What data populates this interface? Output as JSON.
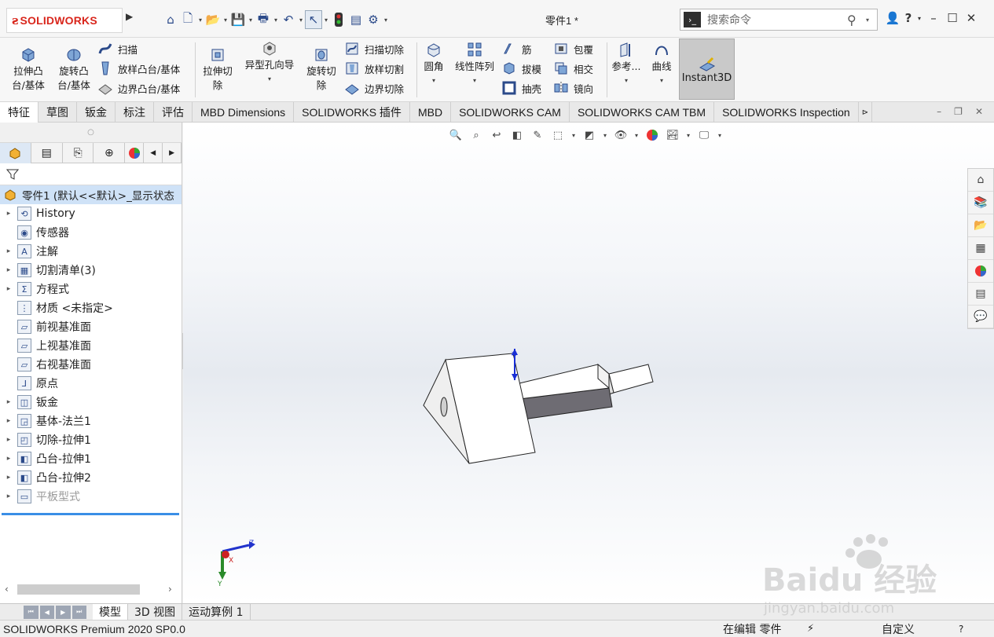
{
  "app": {
    "logo_text": "SOLIDWORKS",
    "document_title": "零件1 *",
    "search_placeholder": "搜索命令"
  },
  "ribbon": {
    "extrude_boss": "拉伸凸\n台/基体",
    "revolve_boss": "旋转凸\n台/基体",
    "sweep": "扫描",
    "loft_boss": "放样凸台/基体",
    "boundary_boss": "边界凸台/基体",
    "extrude_cut": "拉伸切\n除",
    "hole_wizard": "异型孔向导",
    "revolve_cut": "旋转切\n除",
    "sweep_cut": "扫描切除",
    "loft_cut": "放样切割",
    "boundary_cut": "边界切除",
    "fillet": "圆角",
    "linear_pattern": "线性阵列",
    "rib": "筋",
    "draft": "拔模",
    "shell": "抽壳",
    "wrap": "包覆",
    "intersect": "相交",
    "mirror": "镜向",
    "reference": "参考...",
    "curves": "曲线",
    "instant3d": "Instant3D"
  },
  "tabs": [
    "特征",
    "草图",
    "钣金",
    "标注",
    "评估",
    "MBD Dimensions",
    "SOLIDWORKS 插件",
    "MBD",
    "SOLIDWORKS CAM",
    "SOLIDWORKS CAM TBM",
    "SOLIDWORKS Inspection"
  ],
  "tree": {
    "root": "零件1  (默认<<默认>_显示状态",
    "items": [
      {
        "label": "History",
        "icon": "history-icon",
        "expand": true
      },
      {
        "label": "传感器",
        "icon": "sensor-icon",
        "expand": false
      },
      {
        "label": "注解",
        "icon": "annotation-icon",
        "expand": true
      },
      {
        "label": "切割清单(3)",
        "icon": "cutlist-icon",
        "expand": true
      },
      {
        "label": "方程式",
        "icon": "equation-icon",
        "expand": true
      },
      {
        "label": "材质 <未指定>",
        "icon": "material-icon",
        "expand": false
      },
      {
        "label": "前视基准面",
        "icon": "plane-icon",
        "expand": false
      },
      {
        "label": "上视基准面",
        "icon": "plane-icon",
        "expand": false
      },
      {
        "label": "右视基准面",
        "icon": "plane-icon",
        "expand": false
      },
      {
        "label": "原点",
        "icon": "origin-icon",
        "expand": false
      },
      {
        "label": "钣金",
        "icon": "sheetmetal-icon",
        "expand": true
      },
      {
        "label": "基体-法兰1",
        "icon": "base-flange-icon",
        "expand": true
      },
      {
        "label": "切除-拉伸1",
        "icon": "cut-extrude-icon",
        "expand": true
      },
      {
        "label": "凸台-拉伸1",
        "icon": "boss-extrude-icon",
        "expand": true
      },
      {
        "label": "凸台-拉伸2",
        "icon": "boss-extrude-icon",
        "expand": true
      },
      {
        "label": "平板型式",
        "icon": "flat-pattern-icon",
        "expand": true,
        "dim": true
      }
    ]
  },
  "triad": {
    "x": "X",
    "y": "Y",
    "z": "Z"
  },
  "bottom_tabs": [
    "模型",
    "3D 视图",
    "运动算例 1"
  ],
  "status": {
    "product": "SOLIDWORKS Premium 2020 SP0.0",
    "editing": "在编辑 零件",
    "units": "自定义",
    "help": "?"
  },
  "watermark": {
    "brand": "Baidu 经验",
    "url": "jingyan.baidu.com"
  }
}
